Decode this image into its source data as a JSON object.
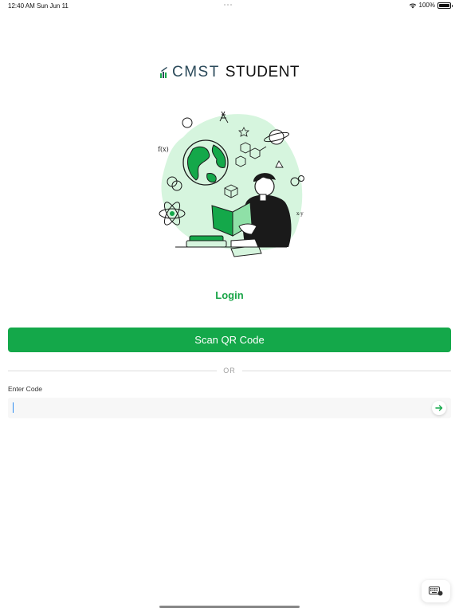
{
  "status_bar": {
    "time": "12:40 AM",
    "date": "Sun Jun 11",
    "battery": "100%",
    "icons": [
      "wifi-icon",
      "battery-icon"
    ]
  },
  "logo": {
    "cmst": "CMST",
    "student": "STUDENT",
    "icon": "graduation-book-logo-icon"
  },
  "illustration": {
    "alt_icon": "student-reading-illustration"
  },
  "login": {
    "title": "Login"
  },
  "scan": {
    "label": "Scan QR Code"
  },
  "divider": {
    "text": "OR"
  },
  "code": {
    "label": "Enter Code",
    "value": "",
    "submit_icon": "arrow-right-icon"
  },
  "keyboard": {
    "icon": "keyboard-icon"
  },
  "colors": {
    "accent": "#14a84a",
    "accent_text": "#1aa548",
    "illustration_blob": "#d6f5de",
    "logo_dark": "#2b4a5a"
  }
}
